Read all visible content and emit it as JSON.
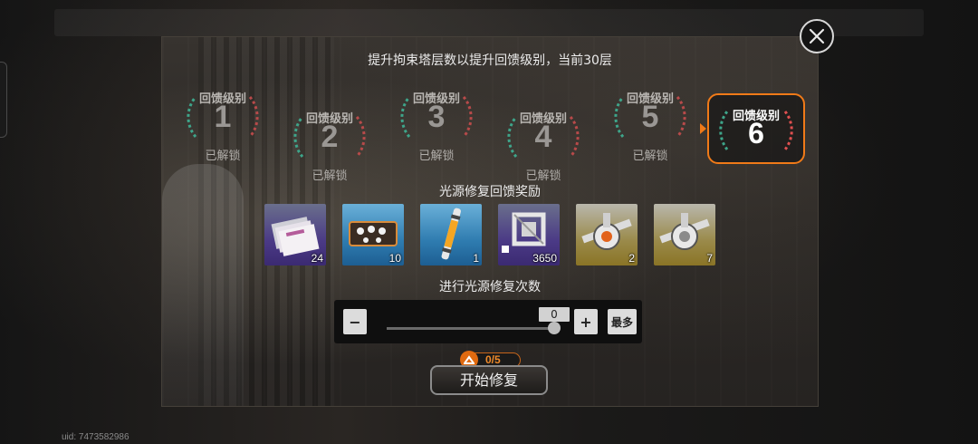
{
  "uid_text": "uid: 7473582986",
  "dialog": {
    "header": "提升拘束塔层数以提升回馈级别，当前30层",
    "levels": [
      {
        "label": "回馈级别",
        "number": "1",
        "status": "已解锁"
      },
      {
        "label": "回馈级别",
        "number": "2",
        "status": "已解锁"
      },
      {
        "label": "回馈级别",
        "number": "3",
        "status": "已解锁"
      },
      {
        "label": "回馈级别",
        "number": "4",
        "status": "已解锁"
      },
      {
        "label": "回馈级别",
        "number": "5",
        "status": "已解锁"
      },
      {
        "label": "回馈级别",
        "number": "6",
        "status": ""
      }
    ],
    "current_level_index": 5,
    "rewards_title": "光源修复回馈奖励",
    "rewards": [
      {
        "icon": "document-stack-icon",
        "quantity": "24",
        "rarity": "purple"
      },
      {
        "icon": "material-case-icon",
        "quantity": "10",
        "rarity": "blue"
      },
      {
        "icon": "energy-rod-icon",
        "quantity": "1",
        "rarity": "blue"
      },
      {
        "icon": "module-chip-icon",
        "quantity": "3650",
        "rarity": "purple"
      },
      {
        "icon": "gear-part-icon",
        "quantity": "2",
        "rarity": "gold"
      },
      {
        "icon": "gear-part-icon",
        "quantity": "7",
        "rarity": "gold"
      }
    ],
    "repair_title": "进行光源修复次数",
    "stepper": {
      "minus_label": "−",
      "plus_label": "+",
      "max_label": "最多",
      "value": "0",
      "fraction": 1.0
    },
    "cost": {
      "text": "0/5",
      "icon": "tower-coin-icon"
    },
    "start_label": "开始修复"
  },
  "colors": {
    "accent": "#f07a18",
    "cost_text": "#f08a2a"
  }
}
